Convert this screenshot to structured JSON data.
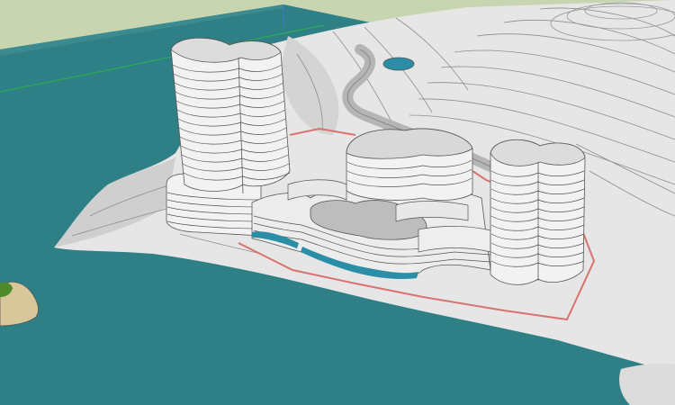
{
  "viewport": {
    "kind": "3d-model-view",
    "colors": {
      "sky": "#c7d6b0",
      "water": "#2f7f86",
      "water_dark": "#256c73",
      "terrain": "#e6e6e6",
      "terrain_shadow": "#bdbdbd",
      "contour": "#8e8e8e",
      "building": "#f2f2f2",
      "building_shadow": "#cfcfcf",
      "floor_line": "#555555",
      "site_boundary": "#d9736f",
      "pool": "#2a8fa6",
      "island": "#d8c79a",
      "vegetation": "#4e8a2a",
      "axis_green": "#2bb34a"
    }
  }
}
